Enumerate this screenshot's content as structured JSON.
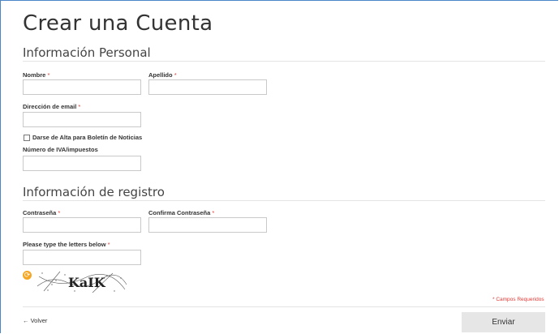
{
  "page": {
    "title": "Crear una Cuenta"
  },
  "personal": {
    "title": "Información Personal",
    "first_name": {
      "label": "Nombre",
      "required_mark": "*",
      "value": ""
    },
    "last_name": {
      "label": "Apellido",
      "required_mark": "*",
      "value": ""
    },
    "email": {
      "label": "Dirección de email",
      "required_mark": "*",
      "value": ""
    },
    "newsletter": {
      "label": "Darse de Alta para Boletín de Noticias",
      "checked": false
    },
    "vat": {
      "label": "Número de IVA/impuestos",
      "value": ""
    }
  },
  "registration": {
    "title": "Información de registro",
    "password": {
      "label": "Contraseña",
      "required_mark": "*",
      "value": ""
    },
    "confirm_password": {
      "label": "Confirma Contraseña",
      "required_mark": "*",
      "value": ""
    },
    "captcha": {
      "label": "Please type the letters below",
      "required_mark": "*",
      "value": "",
      "image_text": "KaIK"
    }
  },
  "footer": {
    "required_note": "* Campos Requeridos",
    "back_label": "← Volver",
    "submit_label": "Enviar"
  }
}
